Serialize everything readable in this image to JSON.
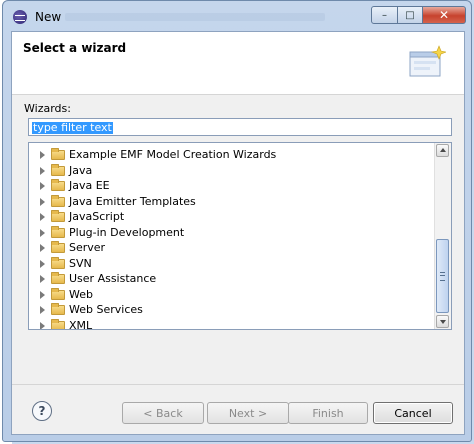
{
  "window": {
    "title": "New",
    "controls": [
      "minimize-icon",
      "maximize-icon",
      "close-icon"
    ]
  },
  "header": {
    "title": "Select a wizard",
    "image_icon": "wizard-banner-icon"
  },
  "filter": {
    "label": "Wizards:",
    "value": "type filter text"
  },
  "tree": {
    "items": [
      {
        "label": "Example EMF Model Creation Wizards"
      },
      {
        "label": "Java"
      },
      {
        "label": "Java EE"
      },
      {
        "label": "Java Emitter Templates"
      },
      {
        "label": "JavaScript"
      },
      {
        "label": "Plug-in Development"
      },
      {
        "label": "Server"
      },
      {
        "label": "SVN"
      },
      {
        "label": "User Assistance"
      },
      {
        "label": "Web"
      },
      {
        "label": "Web Services"
      },
      {
        "label": "XML"
      }
    ]
  },
  "buttons": {
    "help": "?",
    "back": "< Back",
    "next": "Next >",
    "finish": "Finish",
    "cancel": "Cancel"
  },
  "colors": {
    "selection": "#3399ff",
    "folder": "#e6b94d"
  }
}
